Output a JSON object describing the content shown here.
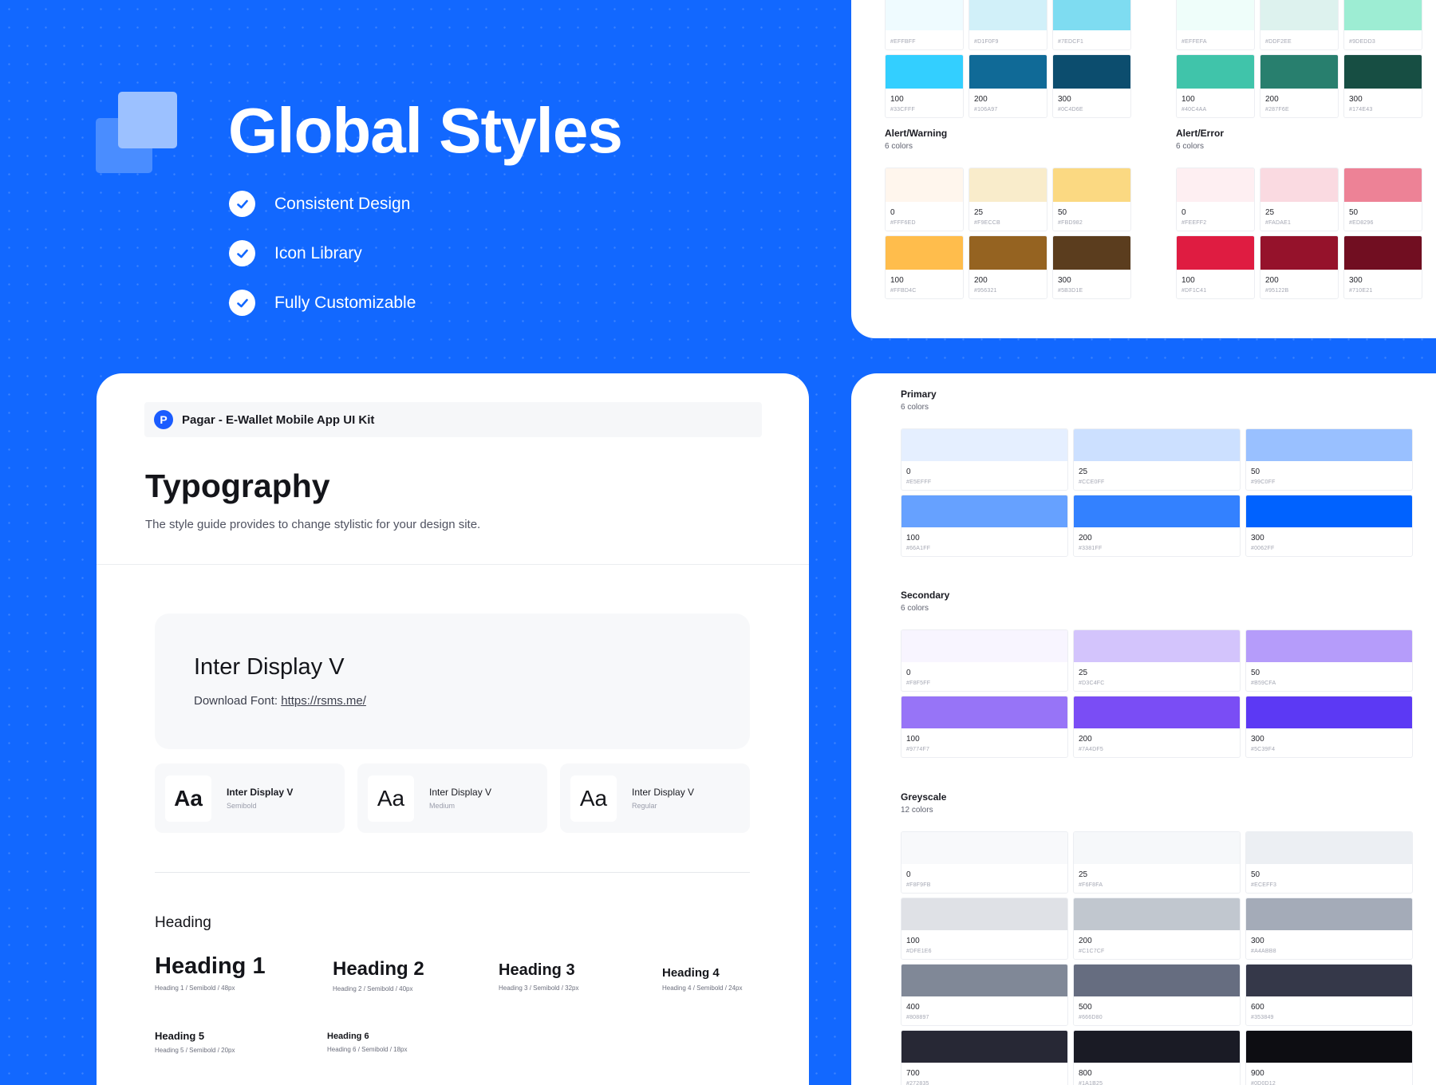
{
  "hero": {
    "title": "Global Styles",
    "features": [
      "Consistent Design",
      "Icon Library",
      "Fully Customizable"
    ],
    "check_icon": "check-circle-icon"
  },
  "alert_palettes": [
    {
      "title": "",
      "count": "",
      "swatches": [
        {
          "name": "",
          "hex": "#EFFBFF",
          "color": "#EFFBFF"
        },
        {
          "name": "",
          "hex": "#D1F0F9",
          "color": "#D1F0F9"
        },
        {
          "name": "",
          "hex": "#7EDCF1",
          "color": "#7EDCF1"
        },
        {
          "name": "100",
          "hex": "#33CFFF",
          "color": "#33CFFF"
        },
        {
          "name": "200",
          "hex": "#106A97",
          "color": "#106A97"
        },
        {
          "name": "300",
          "hex": "#0C4D6E",
          "color": "#0C4D6E"
        }
      ]
    },
    {
      "title": "",
      "count": "",
      "swatches": [
        {
          "name": "",
          "hex": "#EFFEFA",
          "color": "#EFFEFA"
        },
        {
          "name": "",
          "hex": "#DDF2EE",
          "color": "#DDF2EE"
        },
        {
          "name": "",
          "hex": "#9DEDD3",
          "color": "#9DEDD3"
        },
        {
          "name": "100",
          "hex": "#40C4AA",
          "color": "#40C4AA"
        },
        {
          "name": "200",
          "hex": "#287F6E",
          "color": "#287F6E"
        },
        {
          "name": "300",
          "hex": "#174E43",
          "color": "#174E43"
        }
      ]
    },
    {
      "title": "Alert/Warning",
      "count": "6 colors",
      "swatches": [
        {
          "name": "0",
          "hex": "#FFF6ED",
          "color": "#FFF6ED"
        },
        {
          "name": "25",
          "hex": "#F9ECCB",
          "color": "#F9ECCB"
        },
        {
          "name": "50",
          "hex": "#FBD982",
          "color": "#FBD982"
        },
        {
          "name": "100",
          "hex": "#FFBD4C",
          "color": "#FFBD4C"
        },
        {
          "name": "200",
          "hex": "#956321",
          "color": "#956321"
        },
        {
          "name": "300",
          "hex": "#5B3D1E",
          "color": "#5B3D1E"
        }
      ]
    },
    {
      "title": "Alert/Error",
      "count": "6 colors",
      "swatches": [
        {
          "name": "0",
          "hex": "#FEEFF2",
          "color": "#FEEFF2"
        },
        {
          "name": "25",
          "hex": "#FADAE1",
          "color": "#FADAE1"
        },
        {
          "name": "50",
          "hex": "#ED8296",
          "color": "#ED8296"
        },
        {
          "name": "100",
          "hex": "#DF1C41",
          "color": "#DF1C41"
        },
        {
          "name": "200",
          "hex": "#95122B",
          "color": "#95122B"
        },
        {
          "name": "300",
          "hex": "#710E21",
          "color": "#710E21"
        }
      ]
    }
  ],
  "typography": {
    "kit_logo": "P",
    "kit_name": "Pagar - E-Wallet Mobile App UI Kit",
    "title": "Typography",
    "subtitle": "The style guide provides to change stylistic for your design site.",
    "font_name": "Inter Display V",
    "download_label": "Download Font:",
    "download_link": "https://rsms.me/",
    "weights": [
      {
        "sample": "Aa",
        "name": "Inter Display V",
        "style": "Semibold"
      },
      {
        "sample": "Aa",
        "name": "Inter Display V",
        "style": "Medium"
      },
      {
        "sample": "Aa",
        "name": "Inter Display V",
        "style": "Regular"
      }
    ],
    "heading_section": "Heading",
    "headings": [
      {
        "text": "Heading 1",
        "spec": "Heading 1 / Semibold / 48px"
      },
      {
        "text": "Heading 2",
        "spec": "Heading 2 / Semibold / 40px"
      },
      {
        "text": "Heading 3",
        "spec": "Heading 3 / Semibold / 32px"
      },
      {
        "text": "Heading 4",
        "spec": "Heading 4 / Semibold / 24px"
      },
      {
        "text": "Heading 5",
        "spec": "Heading 5 / Semibold / 20px"
      },
      {
        "text": "Heading 6",
        "spec": "Heading 6 / Semibold / 18px"
      }
    ]
  },
  "palettes": [
    {
      "title": "Primary",
      "count": "6 colors",
      "swatches": [
        {
          "name": "0",
          "hex": "#E5EFFF",
          "color": "#E5EFFF"
        },
        {
          "name": "25",
          "hex": "#CCE0FF",
          "color": "#CCE0FF"
        },
        {
          "name": "50",
          "hex": "#99C0FF",
          "color": "#99C0FF"
        },
        {
          "name": "100",
          "hex": "#66A1FF",
          "color": "#66A1FF"
        },
        {
          "name": "200",
          "hex": "#3381FF",
          "color": "#3381FF"
        },
        {
          "name": "300",
          "hex": "#0062FF",
          "color": "#0062FF"
        }
      ]
    },
    {
      "title": "Secondary",
      "count": "6 colors",
      "swatches": [
        {
          "name": "0",
          "hex": "#F8F5FF",
          "color": "#F8F5FF"
        },
        {
          "name": "25",
          "hex": "#D3C4FC",
          "color": "#D3C4FC"
        },
        {
          "name": "50",
          "hex": "#B59CFA",
          "color": "#B59CFA"
        },
        {
          "name": "100",
          "hex": "#9774F7",
          "color": "#9774F7"
        },
        {
          "name": "200",
          "hex": "#7A4DF5",
          "color": "#7A4DF5"
        },
        {
          "name": "300",
          "hex": "#5C39F4",
          "color": "#5C39F4"
        }
      ]
    },
    {
      "title": "Greyscale",
      "count": "12 colors",
      "swatches": [
        {
          "name": "0",
          "hex": "#F8F9FB",
          "color": "#F8F9FB"
        },
        {
          "name": "25",
          "hex": "#F6F8FA",
          "color": "#F6F8FA"
        },
        {
          "name": "50",
          "hex": "#ECEFF3",
          "color": "#ECEFF3"
        },
        {
          "name": "100",
          "hex": "#DFE1E6",
          "color": "#DFE1E6"
        },
        {
          "name": "200",
          "hex": "#C1C7CF",
          "color": "#C1C7CF"
        },
        {
          "name": "300",
          "hex": "#A4ABB8",
          "color": "#A4ABB8"
        },
        {
          "name": "400",
          "hex": "#808897",
          "color": "#808897"
        },
        {
          "name": "500",
          "hex": "#666D80",
          "color": "#666D80"
        },
        {
          "name": "600",
          "hex": "#353849",
          "color": "#353849"
        },
        {
          "name": "700",
          "hex": "#272835",
          "color": "#272835"
        },
        {
          "name": "800",
          "hex": "#1A1B25",
          "color": "#1A1B25"
        },
        {
          "name": "900",
          "hex": "#0D0D12",
          "color": "#0D0D12"
        }
      ]
    }
  ]
}
